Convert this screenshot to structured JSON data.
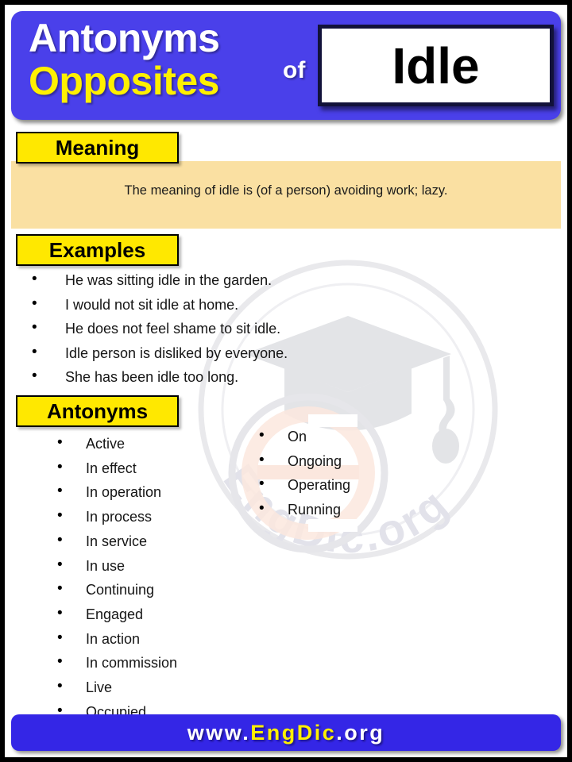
{
  "header": {
    "line1": "Antonyms",
    "line2": "Opposites",
    "connector": "of",
    "word": "Idle"
  },
  "sections": {
    "meaning": {
      "label": "Meaning",
      "text": "The meaning of idle is (of a person) avoiding work; lazy."
    },
    "examples": {
      "label": "Examples",
      "items": [
        "He was sitting idle in the garden.",
        "I would not sit idle at home.",
        "He does not feel shame to sit idle.",
        "Idle person is disliked by everyone.",
        "She has been idle too long."
      ]
    },
    "antonyms": {
      "label": "Antonyms",
      "column_left": [
        "Active",
        "In effect",
        "In operation",
        "In process",
        "In service",
        "In use",
        "Continuing",
        "Engaged",
        "In action",
        "In commission",
        "Live",
        "Occupied"
      ],
      "column_right": [
        "On",
        "Ongoing",
        "Operating",
        "Running"
      ]
    }
  },
  "footer": {
    "prefix": "www.",
    "brand": "EngDic",
    "suffix": ".org"
  },
  "watermark": {
    "text": "EngDic.org",
    "logo": "graduation-cap-logo"
  },
  "colors": {
    "header_blue": "#4a40ea",
    "footer_blue": "#3426e6",
    "label_yellow": "#ffe800",
    "accent_yellow": "#fff000",
    "meaning_band": "#fae0a2",
    "page_border": "#000000"
  }
}
